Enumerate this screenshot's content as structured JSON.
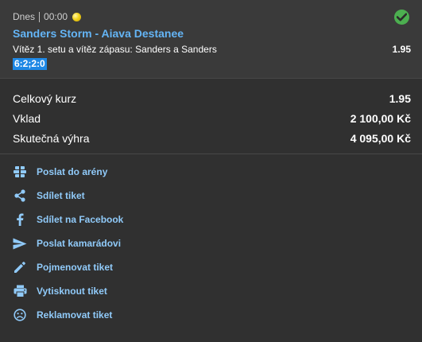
{
  "ticket": {
    "day": "Dnes",
    "time": "00:00",
    "match": "Sanders Storm - Aiava Destanee",
    "market": "Vítěz 1. setu a vítěz zápasu: Sanders a Sanders",
    "odd": "1.95",
    "score": "6:2;2:0"
  },
  "summary": {
    "total_odds_label": "Celkový kurz",
    "total_odds_value": "1.95",
    "stake_label": "Vklad",
    "stake_value": "2 100,00 Kč",
    "win_label": "Skutečná výhra",
    "win_value": "4 095,00 Kč"
  },
  "actions": [
    {
      "label": "Poslat do arény",
      "icon": "arena-icon"
    },
    {
      "label": "Sdílet tiket",
      "icon": "share-icon"
    },
    {
      "label": "Sdílet na Facebook",
      "icon": "facebook-icon"
    },
    {
      "label": "Poslat kamarádovi",
      "icon": "send-icon"
    },
    {
      "label": "Pojmenovat tiket",
      "icon": "pencil-icon"
    },
    {
      "label": "Vytisknout tiket",
      "icon": "printer-icon"
    },
    {
      "label": "Reklamovat tiket",
      "icon": "sad-face-icon"
    }
  ],
  "colors": {
    "background": "#303030",
    "header_background": "#3a3a3a",
    "accent_blue": "#64b5f6",
    "link_blue": "#90caf9",
    "score_badge": "#1e88e5",
    "success_green": "#4caf50",
    "tennis_ball": "#f1d21c"
  }
}
